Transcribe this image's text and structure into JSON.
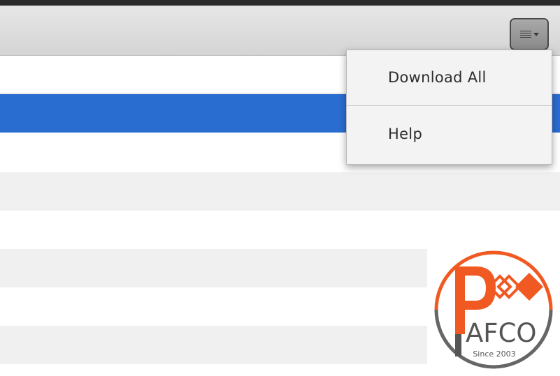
{
  "toolbar": {
    "menu_button_icon": "hamburger-dropdown-icon"
  },
  "dropdown": {
    "items": [
      {
        "label": "Download All"
      },
      {
        "label": "Help"
      }
    ]
  },
  "list": {
    "selected_color": "#2a6dd0",
    "stripe_color": "#f0f0f0"
  },
  "logo": {
    "brand_letters": "PAFCO",
    "since_text": "Since 2003",
    "accent_color": "#f05a22",
    "ring_color": "#666666"
  }
}
